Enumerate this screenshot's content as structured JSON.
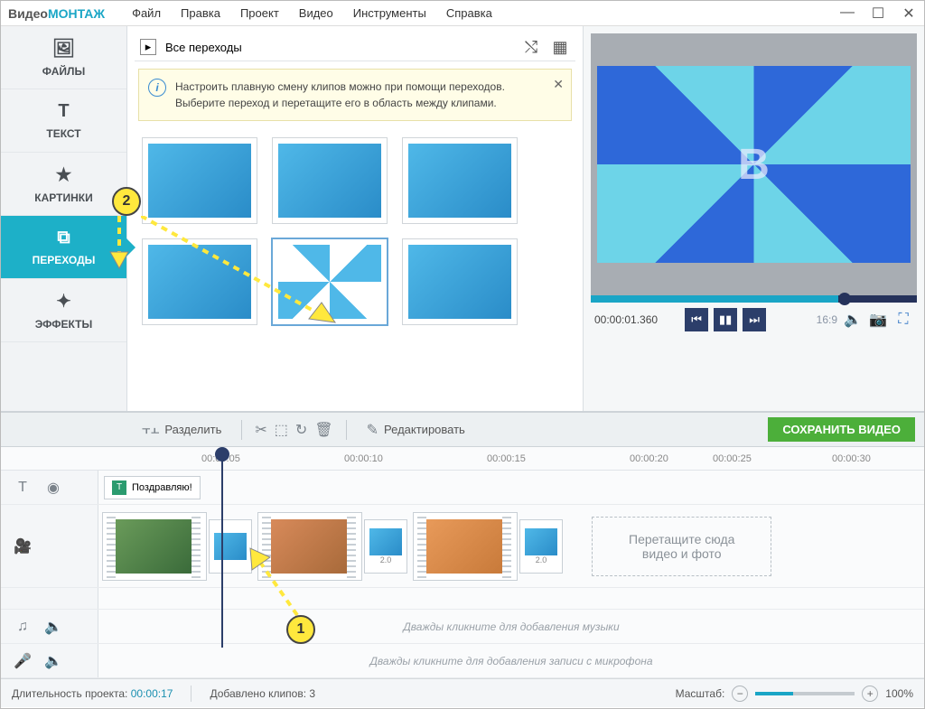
{
  "app": {
    "name1": "Видео",
    "name2": "МОНТАЖ"
  },
  "menu": [
    "Файл",
    "Правка",
    "Проект",
    "Видео",
    "Инструменты",
    "Справка"
  ],
  "sidebar": {
    "items": [
      {
        "label": "ФАЙЛЫ",
        "icon": "🖼"
      },
      {
        "label": "ТЕКСТ",
        "icon": "T"
      },
      {
        "label": "КАРТИНКИ",
        "icon": "★"
      },
      {
        "label": "ПЕРЕХОДЫ",
        "icon": "⧉"
      },
      {
        "label": "ЭФФЕКТЫ",
        "icon": "✦"
      }
    ],
    "active_index": 3
  },
  "center": {
    "header_label": "Все переходы",
    "info_text": "Настроить плавную смену клипов можно при помощи переходов. Выберите переход и перетащите его в область между клипами."
  },
  "preview": {
    "letter": "B",
    "timecode": "00:00:01.360",
    "aspect": "16:9"
  },
  "toolbar": {
    "split": "Разделить",
    "edit": "Редактировать",
    "save": "СОХРАНИТЬ ВИДЕО"
  },
  "ruler": {
    "ticks": [
      {
        "label": "00:00:05",
        "pos": 222
      },
      {
        "label": "00:00:10",
        "pos": 380
      },
      {
        "label": "00:00:15",
        "pos": 538
      },
      {
        "label": "00:00:20",
        "pos": 696
      },
      {
        "label": "00:00:25",
        "pos": 788
      },
      {
        "label": "00:00:30",
        "pos": 920
      }
    ]
  },
  "timeline": {
    "text_clip": "Поздравляю!",
    "transition_duration": "2.0",
    "drop_hint_line1": "Перетащите сюда",
    "drop_hint_line2": "видео и фото",
    "music_hint": "Дважды кликните для добавления музыки",
    "mic_hint": "Дважды кликните для добавления записи с микрофона"
  },
  "status": {
    "duration_label": "Длительность проекта:",
    "duration_value": "00:00:17",
    "clips_label": "Добавлено клипов:",
    "clips_value": "3",
    "zoom_label": "Масштаб:",
    "zoom_value": "100%"
  },
  "annotations": {
    "marker1": "1",
    "marker2": "2"
  }
}
